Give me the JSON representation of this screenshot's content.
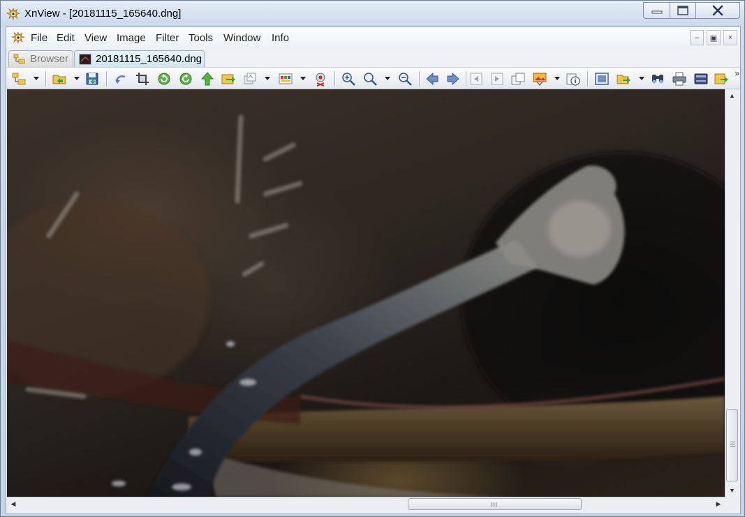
{
  "window": {
    "title": "XnView - [20181115_165640.dng]",
    "icon": "xnview-eye-icon",
    "controls": [
      "minimize-icon",
      "maximize-icon",
      "close-icon"
    ]
  },
  "menu": {
    "items": [
      "File",
      "Edit",
      "View",
      "Image",
      "Filter",
      "Tools",
      "Window",
      "Info"
    ],
    "mdi_controls": {
      "minimize": "–",
      "restore": "▣",
      "close": "×"
    }
  },
  "tabs": [
    {
      "label": "Browser",
      "active": false,
      "icon": "browser-tree-icon"
    },
    {
      "label": "20181115_165640.dng",
      "active": true,
      "icon": "image-thumbnail-icon"
    }
  ],
  "toolbar": {
    "buttons": [
      "browser-tree-icon",
      "open-folder-icon",
      "save-icon",
      "undo-icon",
      "crop-icon",
      "rotate-left-icon",
      "rotate-right-icon",
      "move-up-icon",
      "export-icon",
      "batch-convert-icon",
      "color-palette-icon",
      "red-eye-icon",
      "zoom-in-icon",
      "zoom-tool-icon",
      "zoom-out-icon",
      "previous-icon",
      "next-icon",
      "first-page-icon",
      "last-page-icon",
      "multipage-icon",
      "slideshow-icon",
      "info-icon",
      "fullscreen-icon",
      "copy-to-icon",
      "find-icon",
      "print-icon",
      "scanner-icon",
      "acquire-icon"
    ],
    "overflow": "»"
  },
  "image": {
    "subject": "dark-photo-branch"
  },
  "scrollbars": {
    "up_arrow": "▲",
    "down_arrow": "▼",
    "left_arrow": "◀",
    "right_arrow": "▶"
  },
  "colors": {
    "titlebar": "#d6e2f0",
    "active_tab": "#cfe5f5",
    "close_button_glyph": "#2b3a52"
  }
}
